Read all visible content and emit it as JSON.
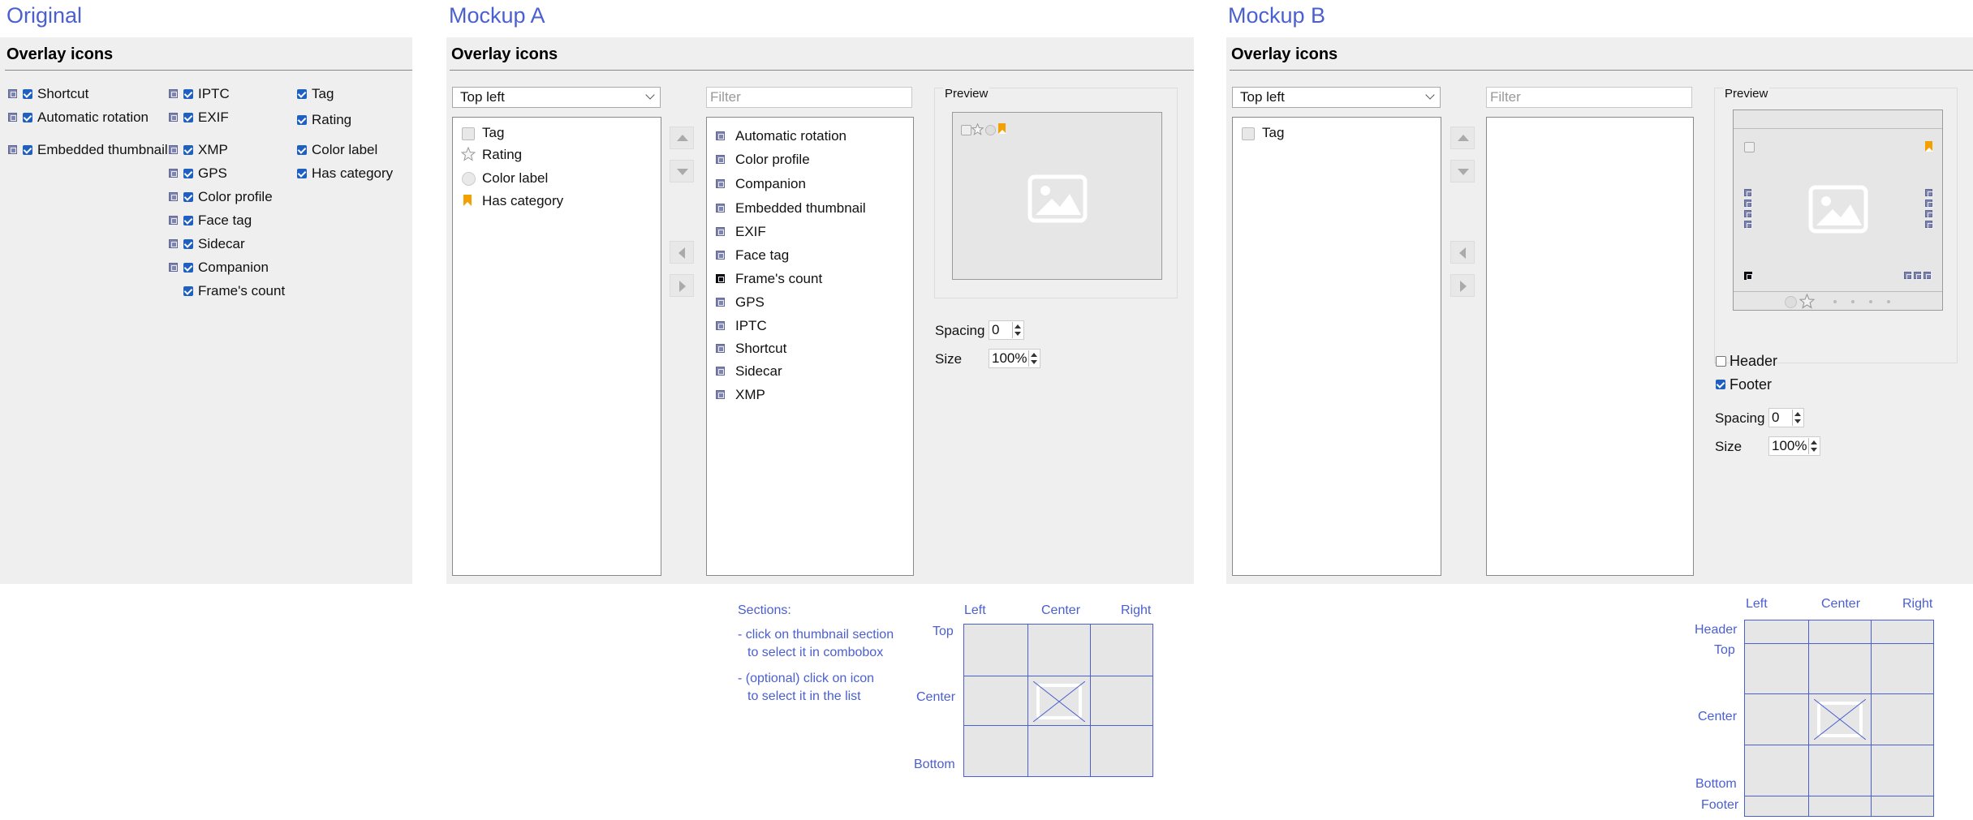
{
  "headers": {
    "original": "Original",
    "mockup_a": "Mockup A",
    "mockup_b": "Mockup B"
  },
  "panel_title": "Overlay icons",
  "original": {
    "col1": [
      "Shortcut",
      "Automatic rotation",
      "Embedded thumbnail"
    ],
    "col2": [
      "IPTC",
      "EXIF",
      "XMP",
      "GPS",
      "Color profile",
      "Face tag",
      "Sidecar",
      "Companion",
      "Frame's count"
    ],
    "col3": [
      "Tag",
      "Rating",
      "Color label",
      "Has category"
    ]
  },
  "mockup_a": {
    "combo": "Top left",
    "filter_placeholder": "Filter",
    "left_list": [
      "Tag",
      "Rating",
      "Color label",
      "Has category"
    ],
    "right_list": [
      "Automatic rotation",
      "Color profile",
      "Companion",
      "Embedded thumbnail",
      "EXIF",
      "Face tag",
      "Frame's count",
      "GPS",
      "IPTC",
      "Shortcut",
      "Sidecar",
      "XMP"
    ],
    "preview_label": "Preview",
    "spacing_label": "Spacing",
    "spacing_value": "0",
    "size_label": "Size",
    "size_value": "100%"
  },
  "mockup_b": {
    "combo": "Top left",
    "filter_placeholder": "Filter",
    "left_list": [
      "Tag"
    ],
    "preview_label": "Preview",
    "header_label": "Header",
    "header_checked": false,
    "footer_label": "Footer",
    "footer_checked": true,
    "spacing_label": "Spacing",
    "spacing_value": "0",
    "size_label": "Size",
    "size_value": "100%"
  },
  "notes_a": {
    "title": "Sections:",
    "line1a": "- click on thumbnail section",
    "line1b": "to select it in combobox",
    "line2a": "- (optional) click on icon",
    "line2b": "to select it in the list"
  },
  "grid_a": {
    "cols": [
      "Left",
      "Center",
      "Right"
    ],
    "rows": [
      "Top",
      "Center",
      "Bottom"
    ]
  },
  "grid_b": {
    "cols": [
      "Left",
      "Center",
      "Right"
    ],
    "rows": [
      "Header",
      "Top",
      "Center",
      "Bottom",
      "Footer"
    ]
  },
  "colors": {
    "accent": "#4a5fd0",
    "check": "#1e5fbf",
    "bookmark": "#f2a100",
    "panel": "#efefef"
  }
}
